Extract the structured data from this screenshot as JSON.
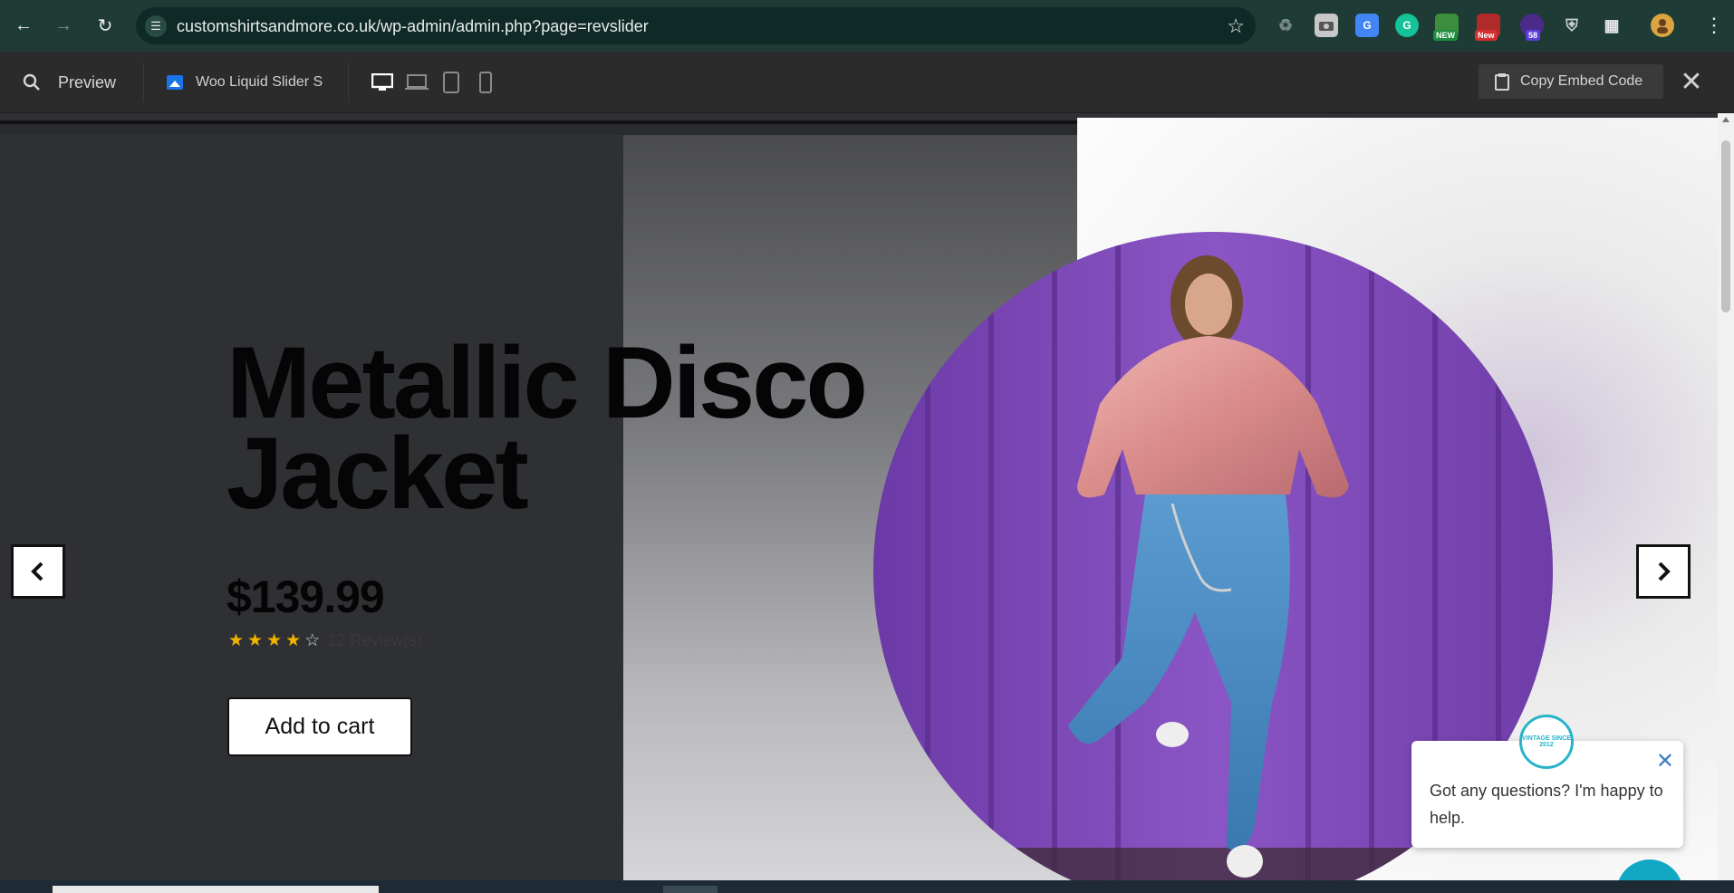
{
  "browser": {
    "url": "customshirtsandmore.co.uk/wp-admin/admin.php?page=revslider",
    "extensions": [
      {
        "name": "recycle-extension-icon",
        "badge": ""
      },
      {
        "name": "camera-extension-icon",
        "badge": ""
      },
      {
        "name": "translate-extension-icon",
        "badge": ""
      },
      {
        "name": "grammarly-extension-icon",
        "badge": ""
      },
      {
        "name": "new-extension-icon",
        "badge": "NEW"
      },
      {
        "name": "new-red-extension-icon",
        "badge": "New"
      },
      {
        "name": "hat-extension-icon",
        "badge": "58"
      },
      {
        "name": "shield-extension-icon",
        "badge": ""
      },
      {
        "name": "puzzle-extension-icon",
        "badge": ""
      }
    ]
  },
  "toolbar": {
    "preview_label": "Preview",
    "slider_name": "Woo Liquid Slider S",
    "copy_embed_label": "Copy Embed Code"
  },
  "slide": {
    "title_line1": "Metallic Disco",
    "title_line2": "Jacket",
    "price": "$139.99",
    "rating_value": 4,
    "rating_max": 5,
    "reviews": "12 Review(s)",
    "cart_label": "Add to cart"
  },
  "chat": {
    "message": "Got any questions? I'm happy to help.",
    "logo_text": "VINTAGE SINCE 2012"
  },
  "colors": {
    "chrome": "#1f3b36",
    "toolbar": "#2b2b2b",
    "stage": "#2f3033",
    "accent": "#1a73e8",
    "star": "#f0b400",
    "chat": "#12a8c4",
    "jacket_bg": "#7f4bb8"
  }
}
